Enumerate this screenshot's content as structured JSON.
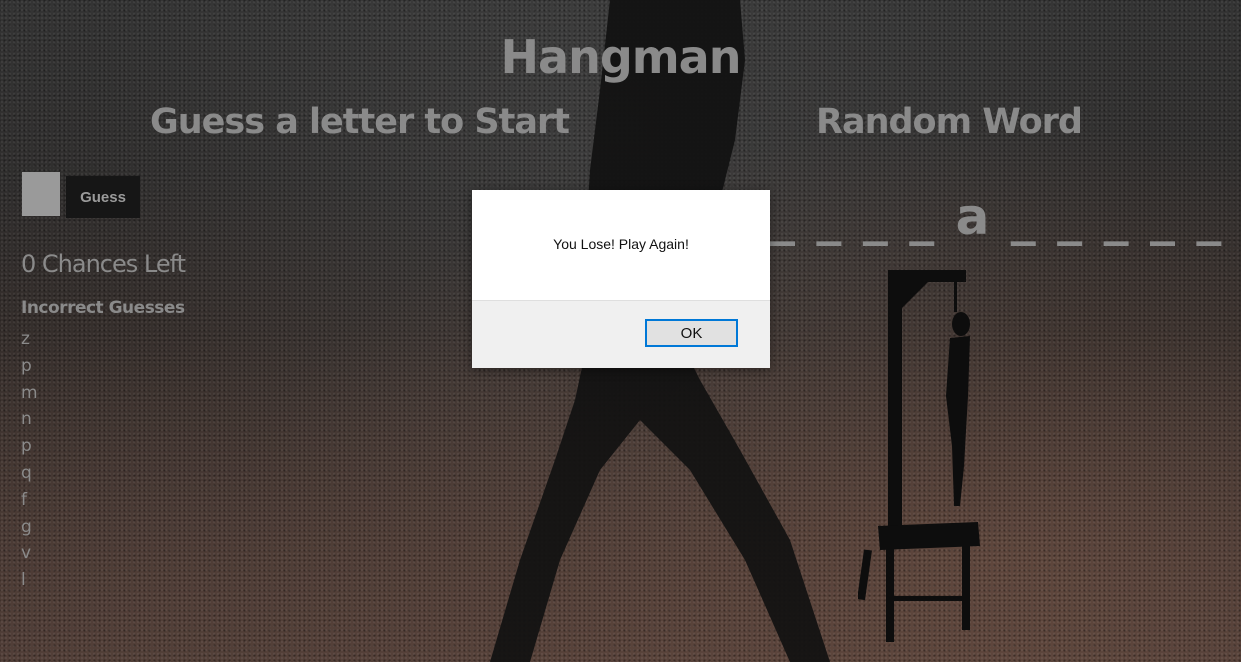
{
  "header": {
    "title": "Hangman",
    "guess_prompt": "Guess a letter to Start",
    "word_heading": "Random Word"
  },
  "guess_form": {
    "input_value": "",
    "button_label": "Guess"
  },
  "status": {
    "chances_text": "0 Chances Left",
    "incorrect_title": "Incorrect Guesses",
    "incorrect_letters": [
      "z",
      "p",
      "m",
      "n",
      "p",
      "q",
      "f",
      "g",
      "v",
      "l"
    ]
  },
  "word_display": "_ _ _ _ a _ _ _ _ _",
  "dialog": {
    "message": "You Lose! Play Again!",
    "ok_label": "OK"
  },
  "colors": {
    "text_gray": "#8a8a8a",
    "dialog_accent": "#0078d7"
  }
}
